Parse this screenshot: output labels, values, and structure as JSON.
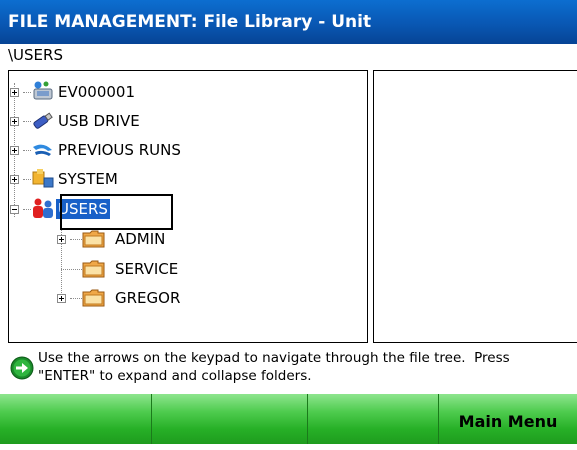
{
  "title": "FILE MANAGEMENT: File Library - Unit",
  "path": "\\USERS",
  "tree": {
    "nodes": [
      {
        "label": "EV000001",
        "icon": "unit-device-icon",
        "expander": "plus"
      },
      {
        "label": "USB DRIVE",
        "icon": "usb-drive-icon",
        "expander": "plus"
      },
      {
        "label": "PREVIOUS RUNS",
        "icon": "previous-runs-icon",
        "expander": "plus"
      },
      {
        "label": "SYSTEM",
        "icon": "system-icon",
        "expander": "plus"
      },
      {
        "label": "USERS",
        "icon": "users-icon",
        "expander": "minus",
        "selected": true
      },
      {
        "label": "ADMIN",
        "icon": "folder-icon",
        "expander": "plus"
      },
      {
        "label": "SERVICE",
        "icon": "folder-icon",
        "expander": "none"
      },
      {
        "label": "GREGOR",
        "icon": "folder-icon",
        "expander": "plus"
      }
    ]
  },
  "help": {
    "icon": "green-arrow-icon",
    "text": "Use the arrows on the keypad to navigate through the file tree.  Press\n\"ENTER\" to expand and collapse folders."
  },
  "softkeys": [
    "",
    "",
    "",
    "Main Menu"
  ],
  "colors": {
    "title_bar": "#0957b3",
    "selection": "#1860c8",
    "softkey_bar": "#27b027",
    "folder": "#e89a3c"
  }
}
